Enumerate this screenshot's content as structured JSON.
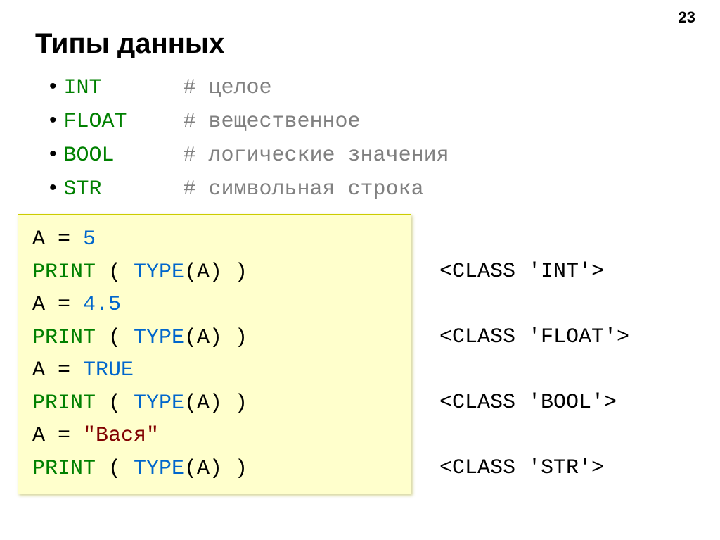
{
  "pageNumber": "23",
  "title": "Типы данных",
  "types": [
    {
      "keyword": "INT",
      "comment": "# целое"
    },
    {
      "keyword": "FLOAT",
      "comment": "# вещественное"
    },
    {
      "keyword": "BOOL",
      "comment": "# логические значения"
    },
    {
      "keyword": "STR",
      "comment": "# символьная строка"
    }
  ],
  "code": {
    "l1a": "A",
    "l1b": " = ",
    "l1c": "5",
    "l2a": "PRINT",
    "l2b": " ( ",
    "l2c": "TYPE",
    "l2d": "(A) )",
    "l3a": "A",
    "l3b": " = ",
    "l3c": "4.5",
    "l4a": "PRINT",
    "l4b": " ( ",
    "l4c": "TYPE",
    "l4d": "(A) )",
    "l5a": "A",
    "l5b": " = ",
    "l5c": "TRUE",
    "l6a": "PRINT",
    "l6b": " ( ",
    "l6c": "TYPE",
    "l6d": "(A) )",
    "l7a": "A",
    "l7b": " = ",
    "l7c": "\"Вася\"",
    "l8a": "PRINT",
    "l8b": " ( ",
    "l8c": "TYPE",
    "l8d": "(A) )"
  },
  "output": {
    "o1": "<CLASS 'INT'>",
    "o2": "<CLASS 'FLOAT'>",
    "o3": "<CLASS 'BOOL'>",
    "o4": "<CLASS 'STR'>"
  }
}
